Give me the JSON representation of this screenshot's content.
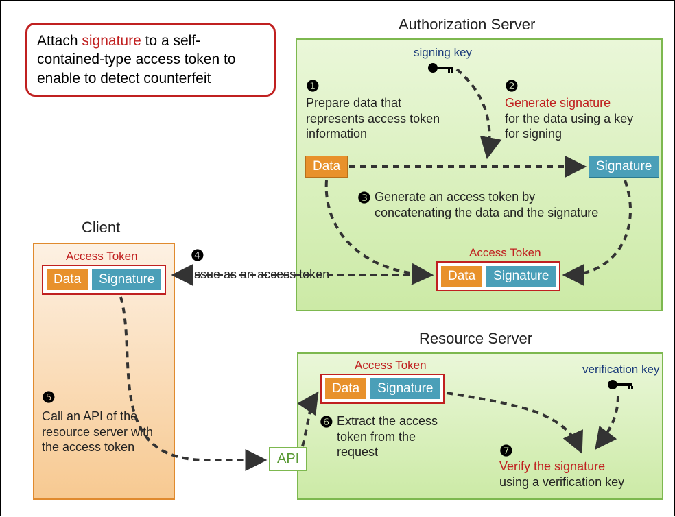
{
  "callout": {
    "prefix": "Attach ",
    "signature": "signature",
    "rest": " to a self-contained-type access token to enable to detect counterfeit"
  },
  "titles": {
    "auth": "Authorization Server",
    "client": "Client",
    "resource": "Resource Server"
  },
  "keys": {
    "signing": "signing key",
    "verification": "verification key"
  },
  "steps": {
    "s1": {
      "num": "❶",
      "text": "Prepare data that represents access token information"
    },
    "s2": {
      "num": "❷",
      "heading": "Generate signature",
      "rest": "for the data using a key for signing"
    },
    "s3": {
      "num": "❸",
      "text": "Generate an access token by concatenating the data and the signature"
    },
    "s4": {
      "num": "❹",
      "text": "Issue as an access token"
    },
    "s5": {
      "num": "❺",
      "text": "Call an API of the resource server with the access token"
    },
    "s6": {
      "num": "❻",
      "text": "Extract the access token from the request"
    },
    "s7": {
      "num": "❼",
      "heading": "Verify the signature",
      "rest": "using a verification key"
    }
  },
  "chips": {
    "data": "Data",
    "signature": "Signature",
    "access_token": "Access Token",
    "api": "API"
  }
}
